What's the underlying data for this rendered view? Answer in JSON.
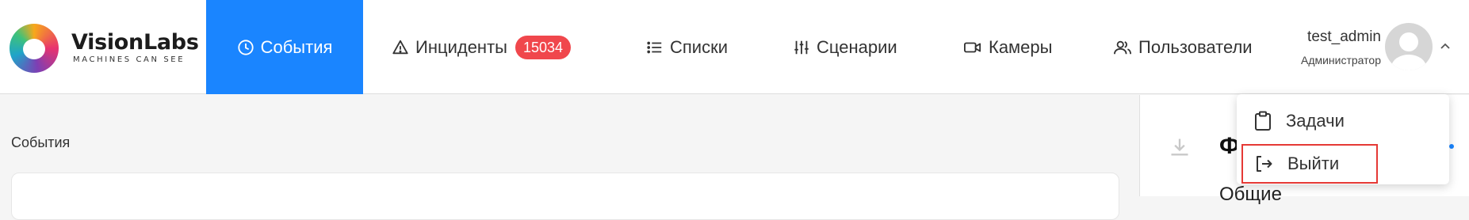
{
  "logo": {
    "title": "VisionLabs",
    "subtitle": "MACHINES CAN SEE"
  },
  "nav": [
    {
      "label": "События",
      "icon": "clock-icon",
      "active": true
    },
    {
      "label": "Инциденты",
      "icon": "warning-icon",
      "badge": "15034"
    },
    {
      "label": "Списки",
      "icon": "list-icon"
    },
    {
      "label": "Сценарии",
      "icon": "sliders-icon"
    },
    {
      "label": "Камеры",
      "icon": "video-camera-icon"
    },
    {
      "label": "Пользователи",
      "icon": "users-icon"
    }
  ],
  "user": {
    "name": "test_admin",
    "role": "Администратор"
  },
  "main": {
    "section_title": "События"
  },
  "side_panel": {
    "heading": "Ф",
    "subheading": "Общие"
  },
  "user_menu": {
    "items": [
      {
        "label": "Задачи",
        "icon": "clipboard-icon"
      },
      {
        "label": "Выйти",
        "icon": "logout-icon",
        "highlighted": true
      }
    ]
  },
  "colors": {
    "accent": "#1a85ff",
    "badge": "#f0474c",
    "highlight_border": "#e53935"
  }
}
